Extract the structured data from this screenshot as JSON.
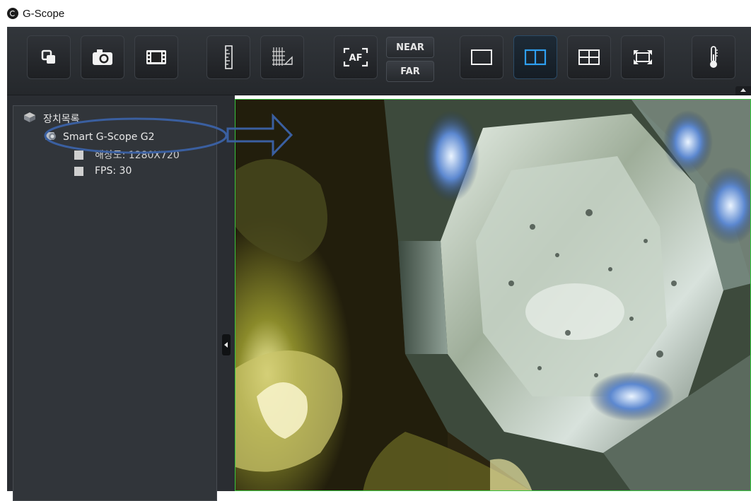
{
  "window": {
    "title": "G-Scope",
    "icon": "g-scope-logo-icon"
  },
  "toolbar": {
    "buttons": [
      {
        "icon": "source-switch-icon"
      },
      {
        "icon": "camera-icon"
      },
      {
        "icon": "film-record-icon"
      },
      {
        "icon": "ruler-icon"
      },
      {
        "icon": "grid-measure-icon"
      },
      {
        "icon": "autofocus-icon",
        "label": "AF"
      },
      {
        "icon": "single-view-icon"
      },
      {
        "icon": "dual-view-icon"
      },
      {
        "icon": "quad-view-icon"
      },
      {
        "icon": "fullscreen-icon"
      },
      {
        "icon": "thermometer-icon"
      }
    ],
    "near_label": "NEAR",
    "far_label": "FAR",
    "active_layout": "dual-view"
  },
  "device_tree": {
    "root_label": "장치목록",
    "device_label": "Smart G-Scope G2",
    "resolution_label": "해상도: 1280X720",
    "fps_label": "FPS: 30"
  },
  "colors": {
    "toolbar_bg": "#2a2d31",
    "panel_bg": "#31353a",
    "active_icon": "#2f9ff0",
    "video_border": "#38c43f",
    "annotation": "#3a5fa0"
  }
}
